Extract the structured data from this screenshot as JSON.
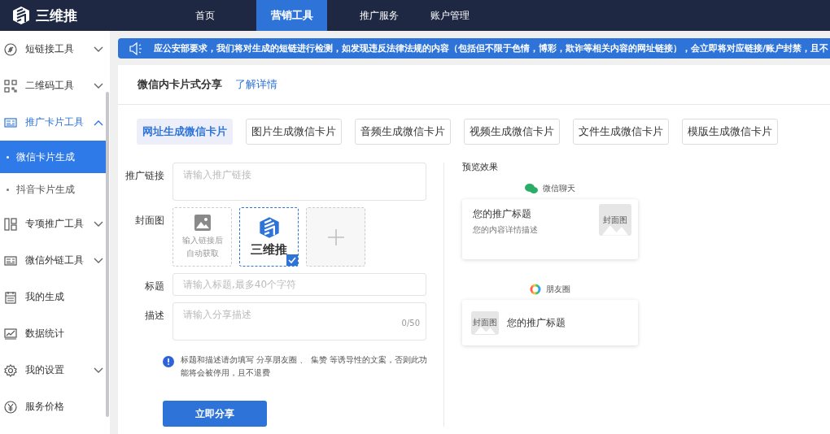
{
  "brand": {
    "name": "三维推"
  },
  "nav": [
    {
      "label": "首页",
      "selected": false
    },
    {
      "label": "营销工具",
      "selected": true
    },
    {
      "label": "推广服务",
      "selected": false
    },
    {
      "label": "账户管理",
      "selected": false
    }
  ],
  "sidebar": {
    "items": [
      {
        "label": "短链接工具",
        "kind": "link",
        "expanded": false
      },
      {
        "label": "二维码工具",
        "kind": "qr",
        "expanded": false
      },
      {
        "label": "推广卡片工具",
        "kind": "card",
        "expanded": true,
        "children": [
          {
            "label": "微信卡片生成",
            "selected": true
          },
          {
            "label": "抖音卡片生成",
            "selected": false
          }
        ]
      },
      {
        "label": "专项推广工具",
        "kind": "split",
        "expanded": false
      },
      {
        "label": "微信外链工具",
        "kind": "card",
        "expanded": false
      },
      {
        "label": "我的生成",
        "kind": "calendar"
      },
      {
        "label": "数据统计",
        "kind": "chart"
      },
      {
        "label": "我的设置",
        "kind": "gear",
        "expanded": false
      },
      {
        "label": "服务价格",
        "kind": "yen"
      }
    ]
  },
  "notice": "应公安部要求，我们将对生成的短链进行检测，如发现违反法律法规的内容（包括但不限于色情，博彩，欺诈等相关内容的网址链接），会立即将对应链接/账户封禁，且不",
  "header": {
    "title": "微信内卡片式分享",
    "link": "了解详情"
  },
  "tabs": [
    {
      "label": "网址生成微信卡片",
      "selected": true
    },
    {
      "label": "图片生成微信卡片",
      "selected": false
    },
    {
      "label": "音频生成微信卡片",
      "selected": false
    },
    {
      "label": "视频生成微信卡片",
      "selected": false
    },
    {
      "label": "文件生成微信卡片",
      "selected": false
    },
    {
      "label": "模版生成微信卡片",
      "selected": false
    }
  ],
  "form": {
    "link": {
      "label": "推广链接",
      "placeholder": "请输入推广链接"
    },
    "cover": {
      "label": "封面图",
      "options": [
        {
          "kind": "auto",
          "text": "输入链接后自动获取",
          "selected": false
        },
        {
          "kind": "logo",
          "text": "三维推",
          "selected": true
        },
        {
          "kind": "add",
          "selected": false
        }
      ]
    },
    "title": {
      "label": "标题",
      "placeholder": "请输入标题,最多40个字符"
    },
    "description": {
      "label": "描述",
      "placeholder": "请输入分享描述",
      "counter": "0/50"
    },
    "hint": "标题和描述请勿填写 分享朋友圈 、 集赞 等诱导性的文案，否则此功能将会被停用，且不退费",
    "submit": "立即分享"
  },
  "preview": {
    "title": "预览效果",
    "chat": {
      "label": "微信聊天",
      "card_title": "您的推广标题",
      "card_desc": "您的内容详情描述",
      "thumb": "封面图"
    },
    "moments": {
      "label": "朋友圈",
      "card_title": "您的推广标题",
      "thumb": "封面图"
    }
  }
}
